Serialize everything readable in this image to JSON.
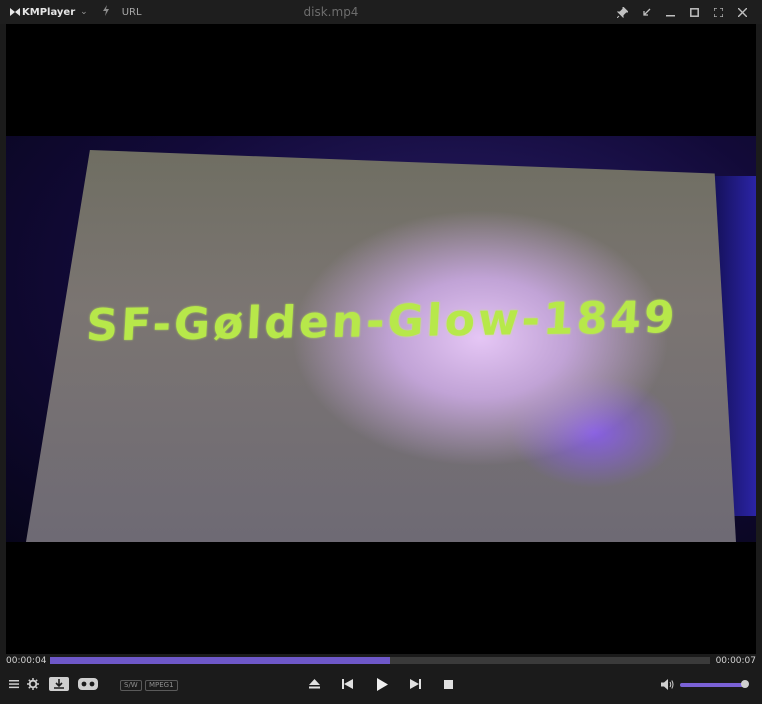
{
  "app": {
    "name": "KMPlayer",
    "url_label": "URL",
    "file_title": "disk.mp4"
  },
  "video": {
    "handwritten_text": "SF-Gølden-Glow-1849"
  },
  "playback": {
    "current_time": "00:00:04",
    "total_time": "00:00:07",
    "progress": 0.515
  },
  "controls": {
    "tag_sw": "S/W",
    "tag_codec": "MPEG1",
    "volume": 0.99
  },
  "colors": {
    "accent": "#6e58c9",
    "scrawl": "#b7e84a"
  },
  "icons": {
    "titlebar": [
      "kmplayer-logo-icon",
      "chevron-down-icon",
      "bolt-icon",
      "pin-icon",
      "shrink-icon",
      "minimize-icon",
      "maximize-icon",
      "fullscreen-icon",
      "close-icon"
    ],
    "controls": [
      "playlist-icon",
      "settings-icon",
      "download-icon",
      "vr-icon",
      "eject-icon",
      "previous-icon",
      "play-icon",
      "next-icon",
      "stop-icon",
      "volume-icon"
    ]
  }
}
